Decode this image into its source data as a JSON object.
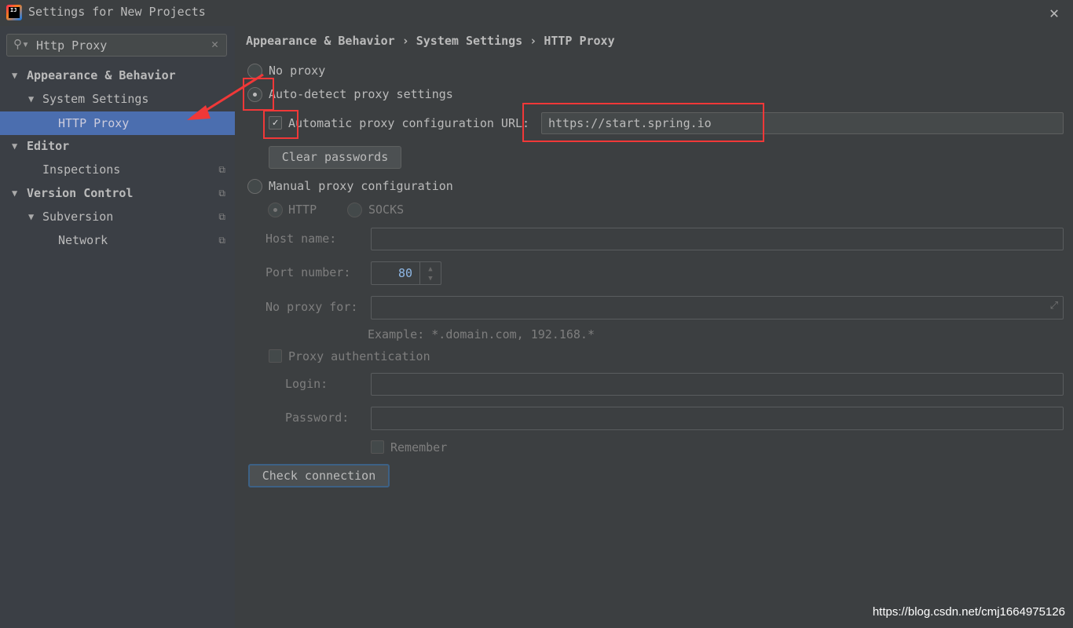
{
  "window": {
    "title": "Settings for New Projects",
    "close_icon": "close-icon",
    "logo": "IJ"
  },
  "search": {
    "value": "Http Proxy"
  },
  "tree": [
    {
      "label": "Appearance & Behavior"
    },
    {
      "label": "System Settings"
    },
    {
      "label": "HTTP Proxy",
      "selected": true
    },
    {
      "label": "Editor"
    },
    {
      "label": "Inspections"
    },
    {
      "label": "Version Control"
    },
    {
      "label": "Subversion"
    },
    {
      "label": "Network"
    }
  ],
  "breadcrumb": {
    "items": [
      "Appearance & Behavior",
      "System Settings",
      "HTTP Proxy"
    ],
    "separator": "›"
  },
  "proxy": {
    "no_proxy": "No proxy",
    "auto_detect": "Auto-detect proxy settings",
    "auto_detect_selected": true,
    "auto_config_label": "Automatic proxy configuration URL:",
    "auto_config_checked": true,
    "auto_config_url": "https://start.spring.io",
    "clear_passwords": "Clear passwords",
    "manual": "Manual proxy configuration",
    "http": "HTTP",
    "socks": "SOCKS",
    "host_label": "Host name:",
    "port_label": "Port number:",
    "port_value": "80",
    "no_proxy_for_label": "No proxy for:",
    "example": "Example: *.domain.com, 192.168.*",
    "proxy_auth": "Proxy authentication",
    "login_label": "Login:",
    "password_label": "Password:",
    "remember": "Remember",
    "check_connection": "Check connection"
  },
  "watermark": "https://blog.csdn.net/cmj1664975126",
  "colors": {
    "selection": "#4b6eaf",
    "annotation": "#f03838"
  }
}
